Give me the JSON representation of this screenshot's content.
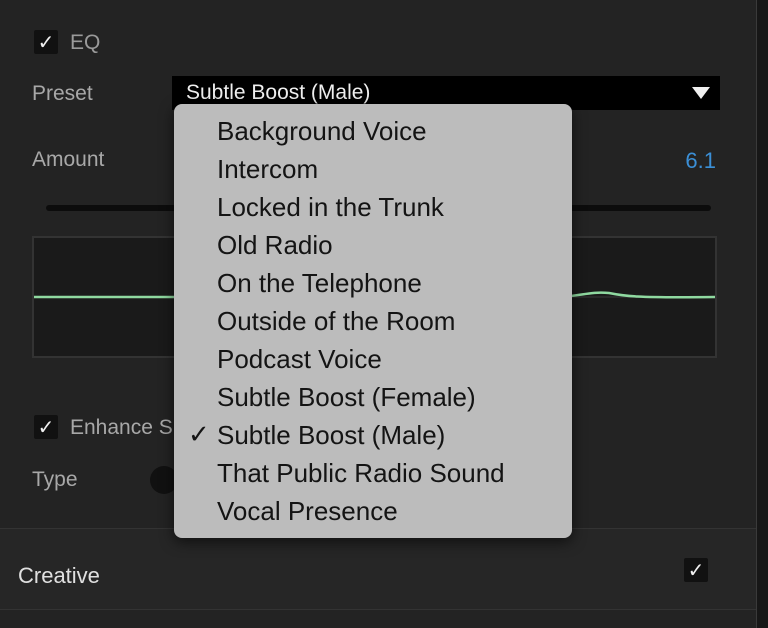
{
  "eq": {
    "checkbox_check": "✓",
    "label": "EQ",
    "enabled": true
  },
  "preset": {
    "label": "Preset",
    "selected": "Subtle Boost (Male)"
  },
  "amount": {
    "label": "Amount",
    "value": "6.1"
  },
  "enhance": {
    "checkbox_check": "✓",
    "label": "Enhance S",
    "enabled": true
  },
  "type": {
    "label": "Type"
  },
  "creative": {
    "label": "Creative",
    "checkbox_check": "✓",
    "enabled": true
  },
  "preset_menu": {
    "check_glyph": "✓",
    "items": [
      {
        "label": "Background Voice",
        "checked": false
      },
      {
        "label": "Intercom",
        "checked": false
      },
      {
        "label": "Locked in the Trunk",
        "checked": false
      },
      {
        "label": "Old Radio",
        "checked": false
      },
      {
        "label": "On the Telephone",
        "checked": false
      },
      {
        "label": "Outside of the Room",
        "checked": false
      },
      {
        "label": "Podcast Voice",
        "checked": false
      },
      {
        "label": "Subtle Boost (Female)",
        "checked": false
      },
      {
        "label": "Subtle Boost (Male)",
        "checked": true
      },
      {
        "label": "That Public Radio Sound",
        "checked": false
      },
      {
        "label": "Vocal Presence",
        "checked": false
      }
    ]
  },
  "colors": {
    "panel_bg": "#232323",
    "accent_blue": "#3b8fd6",
    "eq_curve": "#8fd9a0",
    "menu_bg": "#bcbcbc"
  },
  "icons": {
    "dropdown": "triangle-down-icon",
    "checkbox": "checkmark-icon"
  }
}
